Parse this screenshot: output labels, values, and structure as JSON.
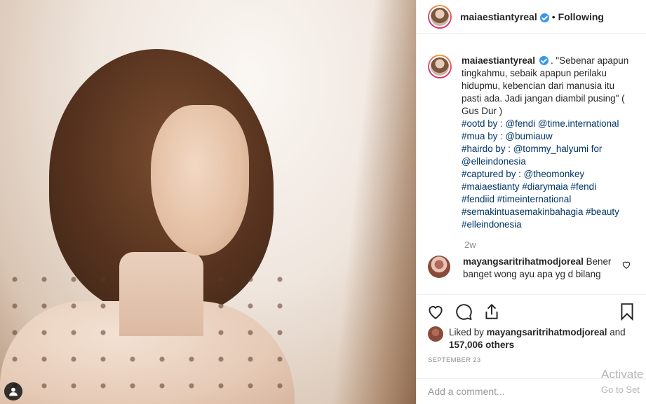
{
  "post": {
    "username": "maiaestiantyreal",
    "follow_status": "Following",
    "separator": "•",
    "caption_body": ". \"Sebenar apapun tingkahmu, sebaik apapun perilaku hidupmu, kebencian dari manusia itu pasti ada. Jadi jangan diambil pusing\" ( Gus Dur )",
    "caption_lines": [
      "#ootd by : @fendi @time.international",
      "#mua by : @bumiauw",
      "#hairdo by : @tommy_halyumi for",
      "@elleindonesia",
      "#captured by : @theomonkey",
      "#maiaestianty #diarymaia #fendi",
      "#fendiid #timeinternational",
      "#semakintuasemakinbahagia #beauty",
      "#elleindonesia"
    ],
    "age": "2w"
  },
  "comment": {
    "username": "mayangsaritrihatmodjoreal",
    "text": "Bener banget wong ayu apa yg d bilang"
  },
  "likes": {
    "prefix": "Liked by",
    "username": "mayangsaritrihatmodjoreal",
    "mid": "and",
    "count": "157,006 others"
  },
  "date": "SEPTEMBER 23",
  "add_comment_placeholder": "Add a comment...",
  "watermark": {
    "line1": "Activate",
    "line2": "Go to Set"
  },
  "colors": {
    "link": "#003569",
    "verified": "#3897f0",
    "muted": "#8e8e8e"
  },
  "icons": [
    "heart-icon",
    "comment-icon",
    "share-icon",
    "bookmark-icon",
    "user-tag-icon",
    "verified-icon"
  ]
}
